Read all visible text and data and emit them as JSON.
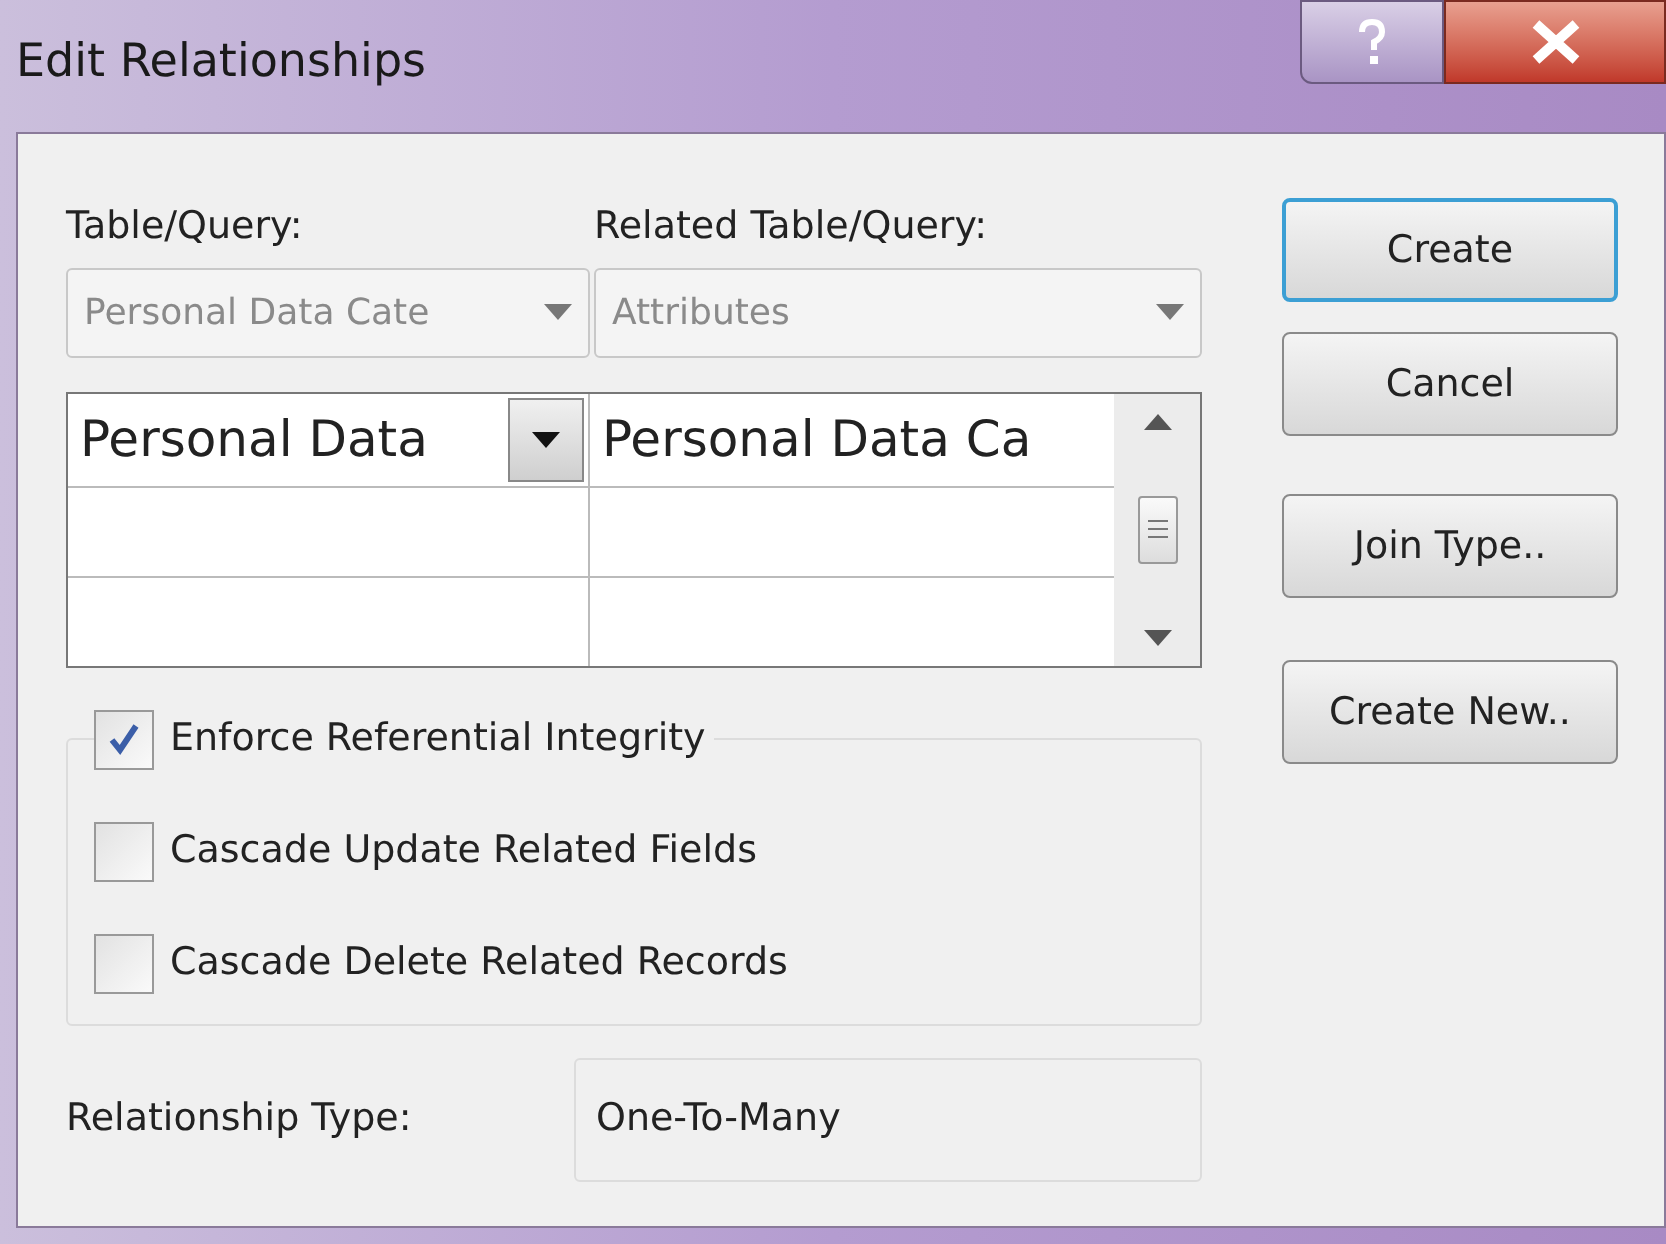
{
  "window": {
    "title": "Edit Relationships"
  },
  "table_query": {
    "label": "Table/Query:",
    "value": "Personal Data Cate",
    "disabled": true
  },
  "related_table_query": {
    "label": "Related Table/Query:",
    "value": "Attributes",
    "disabled": true
  },
  "fields_grid": {
    "rows": [
      {
        "left": "Personal Data",
        "right": "Personal Data Ca"
      }
    ]
  },
  "options": [
    {
      "label": "Enforce Referential Integrity",
      "checked": true
    },
    {
      "label": "Cascade Update Related Fields",
      "checked": false
    },
    {
      "label": "Cascade Delete Related Records",
      "checked": false
    }
  ],
  "relationship_type": {
    "label": "Relationship Type:",
    "value": "One-To-Many"
  },
  "buttons": [
    {
      "label": "Create",
      "default": true
    },
    {
      "label": "Cancel",
      "default": false
    },
    {
      "label": "Join Type..",
      "default": false
    },
    {
      "label": "Create New..",
      "default": false
    }
  ]
}
